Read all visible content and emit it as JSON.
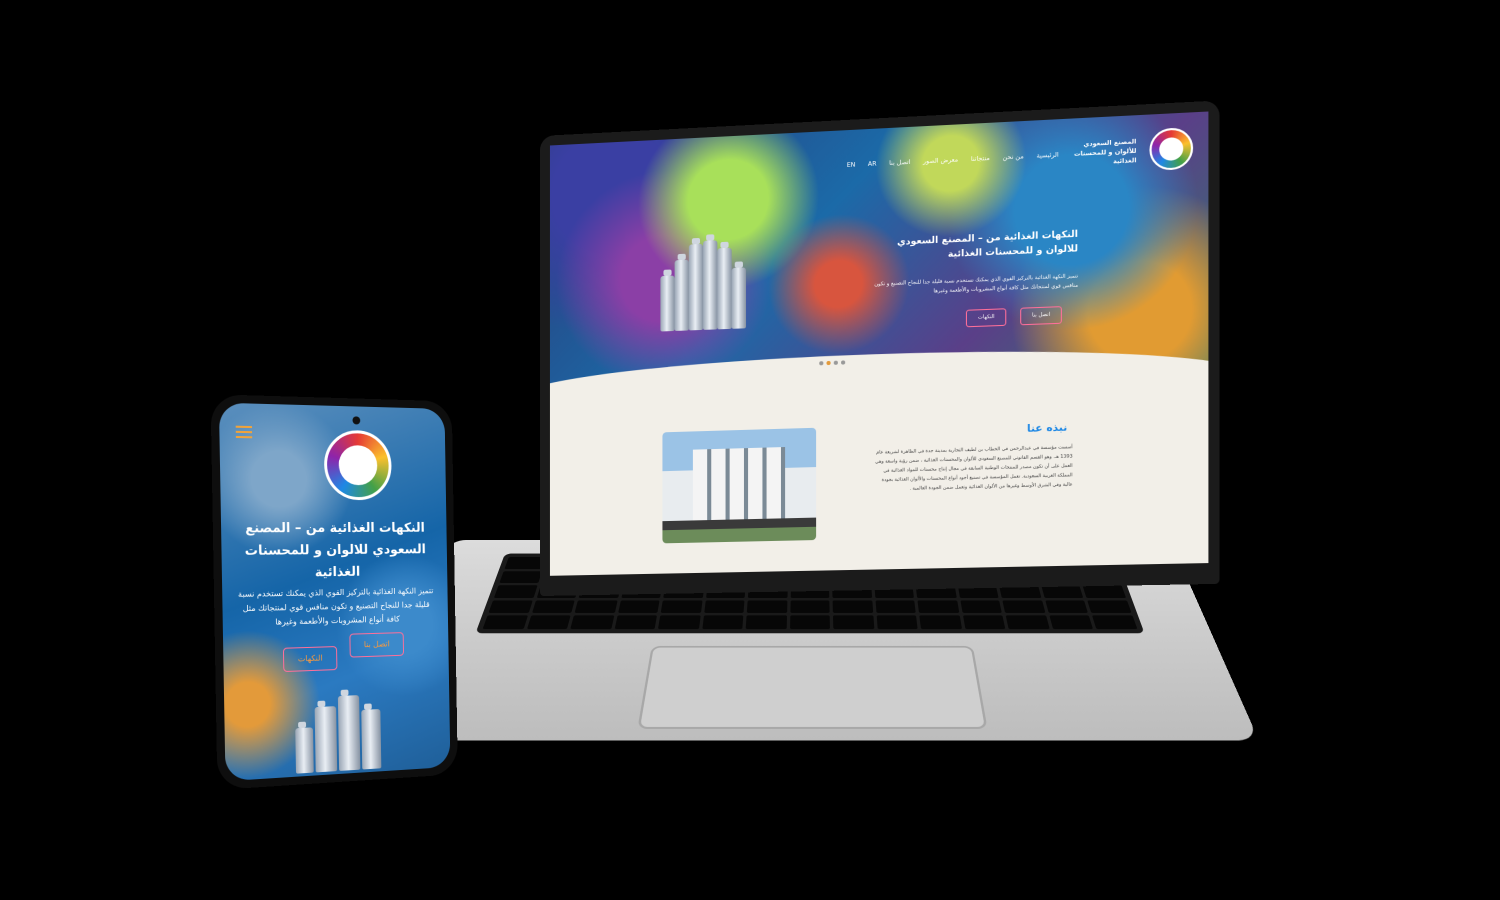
{
  "desktop": {
    "brand": "المصنع السعودي للألوان و للمحسنات الغذائية",
    "nav": [
      "الرئيسية",
      "من نحن",
      "منتجاتنا",
      "معرض الصور",
      "اتصل بنا",
      "AR",
      "EN"
    ],
    "hero": {
      "title": "النكهات الغذائية من – المصنع السعودي للالوان و للمحسنات الغذائية",
      "description": "تتميز النكهة الغذائية بالتركيز القوي الذي يمكنك تستخدم نسبة قليلة جدا للنجاح التصنيع و تكون منافس قوي لمنتجاتك مثل كافة أنواع المشروبات والأطعمة وغيرها",
      "button_primary": "اتصل بنا",
      "button_secondary": "النكهات"
    },
    "about": {
      "title": "نبذه عنا",
      "text": "أسست مؤسسة في عبدالرحمن في الخطاب بن لطيف التجارية بمدينة جدة في الظاهرة لشريعة عام 1393 هـ. وهو القسم القانوني للمصنع السعودي للألوان والمحسنات الغذائية ، ضمن رؤية واسعة وهي العمل على أن تكون مصدر للمنتجات الوطنية السابقة في مجال إنتاج محسنات للمواد الغذائية في المملكة العربية السعودية. تعمل المؤسسة في تصنيع أجود أنواع المحسنات والألوان الغذائية بجودة عالية وفي الشرق الأوسط وغيرها من الألوان الغذائية وتعمل ضمن الجودة العالمية ."
    }
  },
  "mobile": {
    "hero": {
      "title": "النكهات الغذائية من – المصنع السعودي للالوان و للمحسنات الغذائية",
      "description": "تتميز النكهة الغذائية بالتركيز القوي الذي يمكنك تستخدم نسبة قليلة جدا للنجاح التصنيع و تكون منافس قوي لمنتجاتك مثل كافة أنواع المشروبات والأطعمة وغيرها",
      "button_primary": "اتصل بنا",
      "button_secondary": "النكهات"
    }
  }
}
